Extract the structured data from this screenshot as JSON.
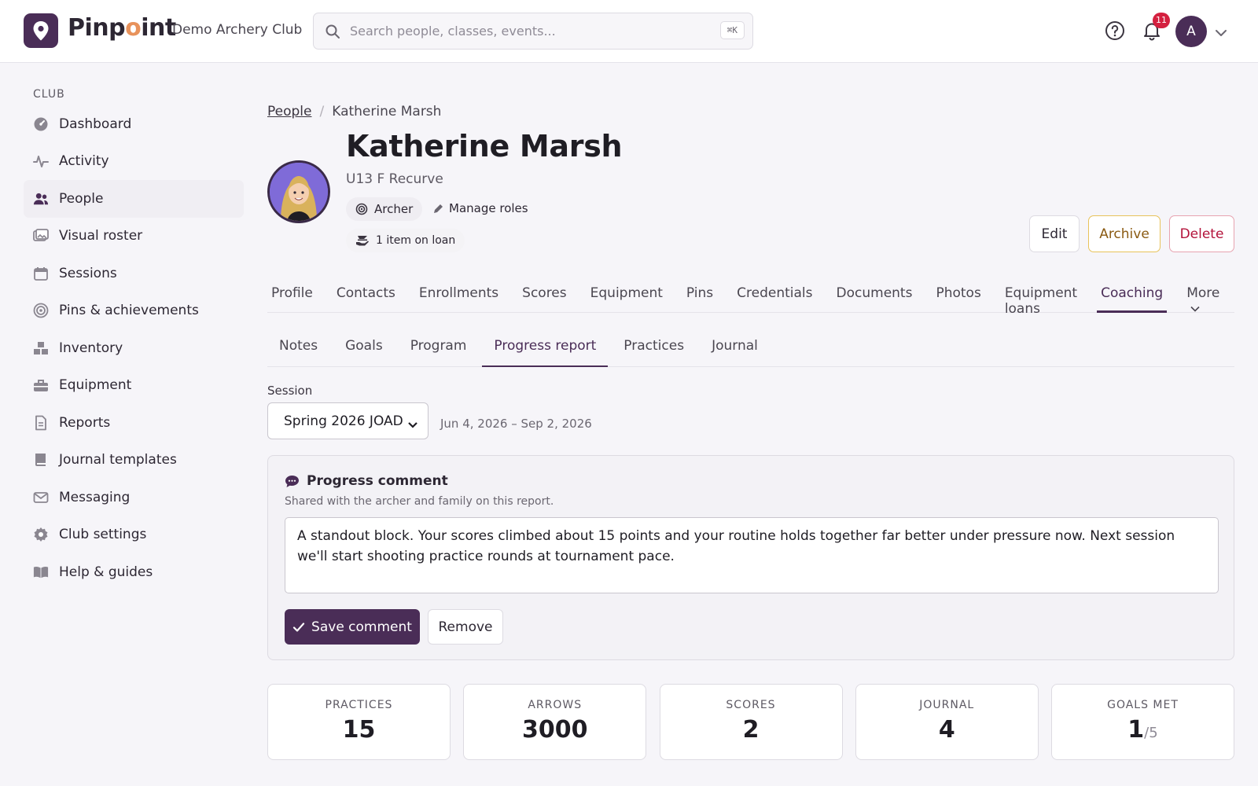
{
  "app": {
    "name_prefix": "Pinp",
    "name_o": "o",
    "name_suffix": "int",
    "club_name": "Demo Archery Club",
    "search_placeholder": "Search people, classes, events...",
    "search_shortcut": "⌘K",
    "notification_count": "11",
    "user_initial": "A"
  },
  "sidebar": {
    "section": "CLUB",
    "items": [
      {
        "label": "Dashboard",
        "icon": "dashboard-icon"
      },
      {
        "label": "Activity",
        "icon": "activity-icon"
      },
      {
        "label": "People",
        "icon": "people-icon",
        "active": true
      },
      {
        "label": "Visual roster",
        "icon": "roster-icon"
      },
      {
        "label": "Sessions",
        "icon": "calendar-icon"
      },
      {
        "label": "Pins & achievements",
        "icon": "target-icon"
      },
      {
        "label": "Inventory",
        "icon": "inventory-icon"
      },
      {
        "label": "Equipment",
        "icon": "toolbox-icon"
      },
      {
        "label": "Reports",
        "icon": "report-icon"
      },
      {
        "label": "Journal templates",
        "icon": "book-icon"
      },
      {
        "label": "Messaging",
        "icon": "mail-icon"
      },
      {
        "label": "Club settings",
        "icon": "gear-icon"
      },
      {
        "label": "Help & guides",
        "icon": "open-book-icon"
      }
    ]
  },
  "breadcrumb": {
    "root": "People",
    "current": "Katherine Marsh"
  },
  "person": {
    "name": "Katherine Marsh",
    "division": "U13 F Recurve",
    "role": "Archer",
    "manage_roles": "Manage roles",
    "loan": "1 item on loan"
  },
  "actions": {
    "edit": "Edit",
    "archive": "Archive",
    "delete": "Delete"
  },
  "tabs": [
    "Profile",
    "Contacts",
    "Enrollments",
    "Scores",
    "Equipment",
    "Pins",
    "Credentials",
    "Documents",
    "Photos",
    "Equipment loans",
    "Coaching",
    "More"
  ],
  "active_tab": "Coaching",
  "subtabs": [
    "Notes",
    "Goals",
    "Program",
    "Progress report",
    "Practices",
    "Journal"
  ],
  "active_subtab": "Progress report",
  "session": {
    "label": "Session",
    "selected": "Spring 2026 JOAD",
    "dates": "Jun 4, 2026 – Sep 2, 2026"
  },
  "comment": {
    "title": "Progress comment",
    "hint": "Shared with the archer and family on this report.",
    "text": "A standout block. Your scores climbed about 15 points and your routine holds together far better under pressure now. Next session we'll start shooting practice rounds at tournament pace.",
    "save": "Save comment",
    "remove": "Remove"
  },
  "stats": [
    {
      "label": "PRACTICES",
      "value": "15"
    },
    {
      "label": "ARROWS",
      "value": "3000"
    },
    {
      "label": "SCORES",
      "value": "2"
    },
    {
      "label": "JOURNAL",
      "value": "4"
    },
    {
      "label": "GOALS MET",
      "value": "1",
      "denominator": "/5"
    }
  ],
  "colors": {
    "brand": "#4a2d57",
    "accent": "#e8925b",
    "badge": "#d4203f"
  }
}
